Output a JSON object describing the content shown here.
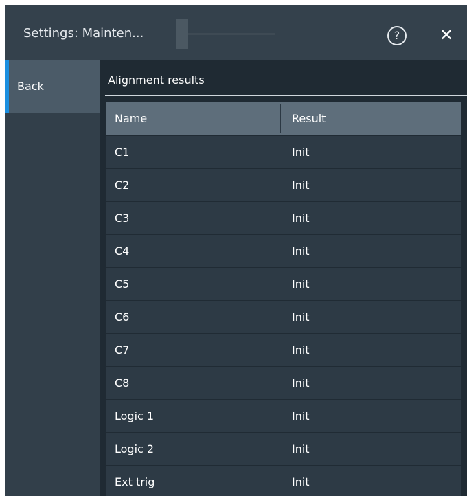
{
  "header": {
    "title": "Settings: Mainten..."
  },
  "sidebar": {
    "back_label": "Back"
  },
  "section": {
    "title": "Alignment results"
  },
  "table": {
    "columns": [
      "Name",
      "Result"
    ],
    "rows": [
      {
        "name": "C1",
        "result": "Init"
      },
      {
        "name": "C2",
        "result": "Init"
      },
      {
        "name": "C3",
        "result": "Init"
      },
      {
        "name": "C4",
        "result": "Init"
      },
      {
        "name": "C5",
        "result": "Init"
      },
      {
        "name": "C6",
        "result": "Init"
      },
      {
        "name": "C7",
        "result": "Init"
      },
      {
        "name": "C8",
        "result": "Init"
      },
      {
        "name": "Logic 1",
        "result": "Init"
      },
      {
        "name": "Logic 2",
        "result": "Init"
      },
      {
        "name": "Ext trig",
        "result": "Init"
      }
    ]
  },
  "icons": {
    "help": "help-circle-icon",
    "close": "close-icon"
  },
  "colors": {
    "accent": "#1b8fe0",
    "header_bg": "#5e6e7b",
    "panel_bg": "#2d3a45"
  }
}
